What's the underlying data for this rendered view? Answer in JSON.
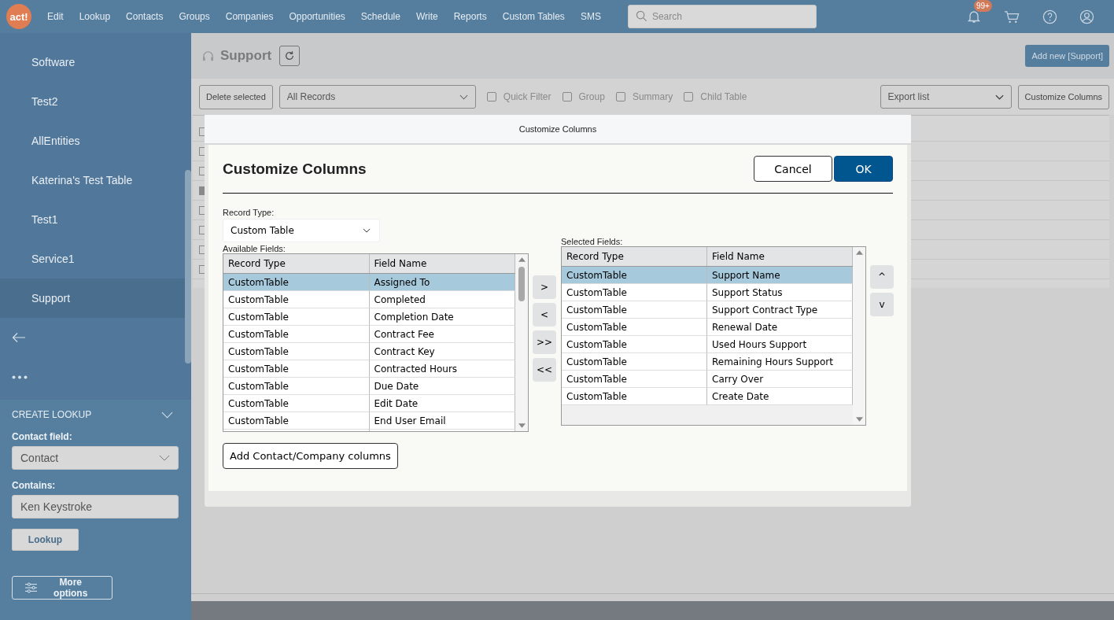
{
  "nav": {
    "logo": "act!",
    "items": [
      "Edit",
      "Lookup",
      "Contacts",
      "Groups",
      "Companies",
      "Opportunities",
      "Schedule",
      "Write",
      "Reports",
      "Custom Tables",
      "SMS"
    ],
    "search": {
      "placeholder": "Search"
    },
    "notification_badge": "99+"
  },
  "sidebar": {
    "items": [
      {
        "label": "Software",
        "selected": false
      },
      {
        "label": "Test2",
        "selected": false
      },
      {
        "label": "AllEntities",
        "selected": false
      },
      {
        "label": "Katerina's Test Table",
        "selected": false
      },
      {
        "label": "Test1",
        "selected": false
      },
      {
        "label": "Service1",
        "selected": false
      },
      {
        "label": "Support",
        "selected": true
      }
    ],
    "lookup": {
      "title": "CREATE LOOKUP",
      "contact_field_label": "Contact field:",
      "contact_field_value": "Contact",
      "contains_label": "Contains:",
      "contains_value": "Ken Keystroke",
      "lookup_button": "Lookup",
      "more_options_button": "More options"
    }
  },
  "page": {
    "title": "Support",
    "add_button": "Add new [Support]",
    "delete_button": "Delete selected",
    "records_filter": "All Records",
    "options": [
      {
        "label": "Quick Filter",
        "checked": false
      },
      {
        "label": "Group",
        "checked": false
      },
      {
        "label": "Summary",
        "checked": false
      },
      {
        "label": "Child Table",
        "checked": false
      }
    ],
    "export": "Export list",
    "customize_button": "Customize Columns",
    "list_rows": [
      {
        "checked": false
      },
      {
        "checked": false
      },
      {
        "checked": false
      },
      {
        "checked": true
      },
      {
        "checked": false
      },
      {
        "checked": false
      },
      {
        "checked": false
      },
      {
        "checked": false
      }
    ]
  },
  "dialog": {
    "window_title": "Customize Columns",
    "heading": "Customize Columns",
    "cancel": "Cancel",
    "ok": "OK",
    "record_type_label": "Record Type:",
    "record_type": "Custom Table",
    "available": {
      "label": "Available Fields:",
      "columns": [
        "Record Type",
        "Field Name"
      ],
      "rows": [
        {
          "record_type": "CustomTable",
          "field_name": "Assigned To",
          "selected": true
        },
        {
          "record_type": "CustomTable",
          "field_name": "Completed",
          "selected": false
        },
        {
          "record_type": "CustomTable",
          "field_name": "Completion Date",
          "selected": false
        },
        {
          "record_type": "CustomTable",
          "field_name": "Contract Fee",
          "selected": false
        },
        {
          "record_type": "CustomTable",
          "field_name": "Contract Key",
          "selected": false
        },
        {
          "record_type": "CustomTable",
          "field_name": "Contracted Hours",
          "selected": false
        },
        {
          "record_type": "CustomTable",
          "field_name": "Due Date",
          "selected": false
        },
        {
          "record_type": "CustomTable",
          "field_name": "Edit Date",
          "selected": false
        },
        {
          "record_type": "CustomTable",
          "field_name": "End User Email",
          "selected": false
        }
      ]
    },
    "move_buttons": [
      ">",
      "<",
      ">>",
      "<<"
    ],
    "selected_fields": {
      "label": "Selected Fields:",
      "columns": [
        "Record Type",
        "Field Name"
      ],
      "rows": [
        {
          "record_type": "CustomTable",
          "field_name": "Support Name",
          "selected": true
        },
        {
          "record_type": "CustomTable",
          "field_name": "Support Status",
          "selected": false
        },
        {
          "record_type": "CustomTable",
          "field_name": "Support Contract Type",
          "selected": false
        },
        {
          "record_type": "CustomTable",
          "field_name": "Renewal Date",
          "selected": false
        },
        {
          "record_type": "CustomTable",
          "field_name": "Used Hours Support",
          "selected": false
        },
        {
          "record_type": "CustomTable",
          "field_name": "Remaining Hours Support",
          "selected": false
        },
        {
          "record_type": "CustomTable",
          "field_name": "Carry Over",
          "selected": false
        },
        {
          "record_type": "CustomTable",
          "field_name": "Create Date",
          "selected": false
        }
      ]
    },
    "order_buttons": [
      "^",
      "v"
    ],
    "add_contact_button": "Add Contact/Company columns"
  }
}
